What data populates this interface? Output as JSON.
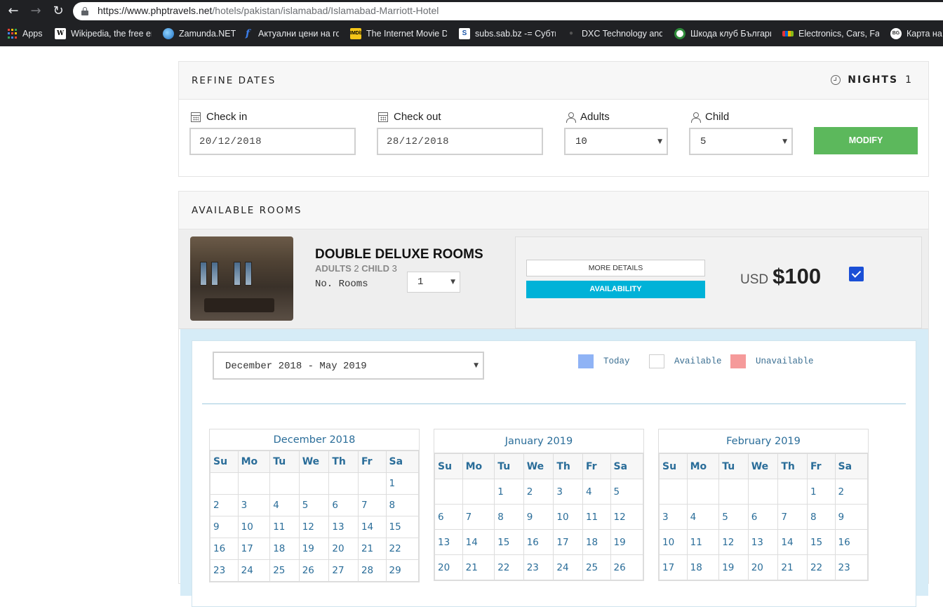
{
  "browser": {
    "url_host": "https://www.phptravels.net",
    "url_path": "/hotels/pakistan/islamabad/Islamabad-Marriott-Hotel",
    "bookmarks": [
      {
        "label": "Apps",
        "icon": "apps-grid-icon"
      },
      {
        "label": "Wikipedia, the free er",
        "icon": "wikipedia-icon"
      },
      {
        "label": "Zamunda.NET",
        "icon": "zamunda-icon"
      },
      {
        "label": "Актуални цени на го",
        "icon": "facebook-f-icon"
      },
      {
        "label": "The Internet Movie D",
        "icon": "imdb-icon"
      },
      {
        "label": "subs.sab.bz -= Субти",
        "icon": "subs-icon"
      },
      {
        "label": "DXC Technology and",
        "icon": "dxc-icon"
      },
      {
        "label": "Шкода клуб Българи",
        "icon": "skoda-icon"
      },
      {
        "label": "Electronics, Cars, Fash",
        "icon": "ebay-icon"
      },
      {
        "label": "Карта на",
        "icon": "map-icon"
      }
    ]
  },
  "refine": {
    "title": "REFINE DATES",
    "nights_label": "NIGHTS",
    "nights_value": "1",
    "checkin_label": "Check in",
    "checkin_value": "20/12/2018",
    "checkout_label": "Check out",
    "checkout_value": "28/12/2018",
    "adults_label": "Adults",
    "adults_value": "10",
    "child_label": "Child",
    "child_value": "5",
    "modify_label": "MODIFY"
  },
  "rooms": {
    "title": "AVAILABLE ROOMS",
    "room": {
      "name": "DOUBLE DELUXE ROOMS",
      "adults_label": "ADULTS",
      "adults_value": "2",
      "child_label": "CHILD",
      "child_value": "3",
      "norooms_label": "No. Rooms",
      "norooms_value": "1",
      "details_label": "MORE DETAILS",
      "availability_label": "AVAILABILITY",
      "currency": "USD",
      "price": "$100",
      "selected": true
    }
  },
  "availability": {
    "range_value": "December 2018 - May 2019",
    "legend": [
      {
        "label": "Today",
        "color": "#8fb3f5"
      },
      {
        "label": "Available",
        "color": "#ffffff"
      },
      {
        "label": "Unavailable",
        "color": "#f59a9a"
      }
    ],
    "weekdays": [
      "Su",
      "Mo",
      "Tu",
      "We",
      "Th",
      "Fr",
      "Sa"
    ],
    "months": [
      {
        "title": "December 2018",
        "weeks": [
          [
            "",
            "",
            "",
            "",
            "",
            "",
            "1"
          ],
          [
            "2",
            "3",
            "4",
            "5",
            "6",
            "7",
            "8"
          ],
          [
            "9",
            "10",
            "11",
            "12",
            "13",
            "14",
            "15"
          ],
          [
            "16",
            "17",
            "18",
            "19",
            "20",
            "21",
            "22"
          ],
          [
            "23",
            "24",
            "25",
            "26",
            "27",
            "28",
            "29"
          ]
        ]
      },
      {
        "title": "January 2019",
        "weeks": [
          [
            "",
            "",
            "1",
            "2",
            "3",
            "4",
            "5"
          ],
          [
            "6",
            "7",
            "8",
            "9",
            "10",
            "11",
            "12"
          ],
          [
            "13",
            "14",
            "15",
            "16",
            "17",
            "18",
            "19"
          ],
          [
            "20",
            "21",
            "22",
            "23",
            "24",
            "25",
            "26"
          ]
        ]
      },
      {
        "title": "February 2019",
        "weeks": [
          [
            "",
            "",
            "",
            "",
            "",
            "1",
            "2"
          ],
          [
            "3",
            "4",
            "5",
            "6",
            "7",
            "8",
            "9"
          ],
          [
            "10",
            "11",
            "12",
            "13",
            "14",
            "15",
            "16"
          ],
          [
            "17",
            "18",
            "19",
            "20",
            "21",
            "22",
            "23"
          ]
        ]
      }
    ]
  }
}
